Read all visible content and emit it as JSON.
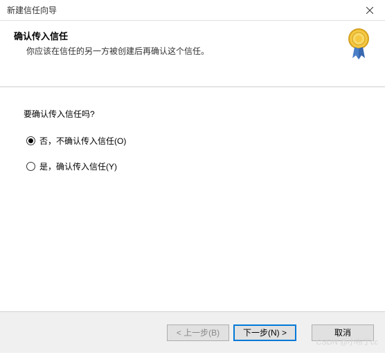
{
  "window": {
    "title": "新建信任向导"
  },
  "header": {
    "title": "确认传入信任",
    "description": "你应该在信任的另一方被创建后再确认这个信任。"
  },
  "content": {
    "question": "要确认传入信任吗?",
    "options": {
      "no": "否，不确认传入信任(O)",
      "yes": "是，确认传入信任(Y)"
    },
    "selected": "no"
  },
  "footer": {
    "back": "< 上一步(B)",
    "next": "下一步(N) >",
    "cancel": "取消"
  },
  "watermark": "CSDN @小布丁cc"
}
